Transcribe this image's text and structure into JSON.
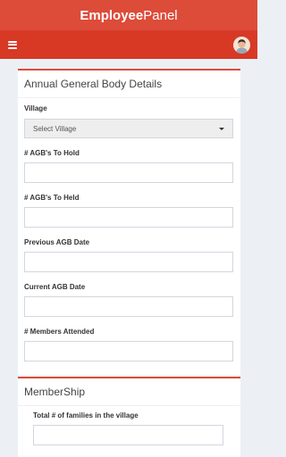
{
  "app": {
    "brand_bold": "Employee",
    "brand_light": "Panel"
  },
  "agb_section": {
    "title": "Annual General Body Details",
    "village_label": "Village",
    "village_value": "Select Village",
    "agbs_to_hold_label": "# AGB's To Hold",
    "agbs_to_held_label": "# AGB's To Held",
    "previous_agb_date_label": "Previous AGB Date",
    "current_agb_date_label": "Current AGB Date",
    "members_attended_label": "# Members Attended"
  },
  "membership_section": {
    "title": "MemberShip",
    "total_families_label": "Total # of families in the village"
  },
  "icons": {
    "menu": "hamburger-menu-icon",
    "profile": "user-avatar-icon",
    "dropdown": "caret-down-icon"
  },
  "colors": {
    "header": "#dd4b39",
    "navbar": "#d73925",
    "background": "#ecf0f5"
  }
}
